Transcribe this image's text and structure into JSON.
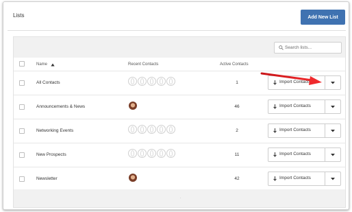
{
  "page": {
    "title": "Lists"
  },
  "toolbar": {
    "add_button_label": "Add New List"
  },
  "search": {
    "placeholder": "Search lists..."
  },
  "table": {
    "headers": {
      "name": "Name",
      "recent": "Recent Contacts",
      "active": "Active Contacts"
    },
    "sort_column": "Name",
    "sort_direction": "ascending",
    "rows": [
      {
        "name": "All Contacts",
        "active": "1",
        "recent_avatars": "placeholders"
      },
      {
        "name": "Announcements & News",
        "active": "46",
        "recent_avatars": "photo"
      },
      {
        "name": "Networking Events",
        "active": "2",
        "recent_avatars": "placeholders"
      },
      {
        "name": "New Prospects",
        "active": "11",
        "recent_avatars": "placeholders"
      },
      {
        "name": "Newsletter",
        "active": "42",
        "recent_avatars": "photo"
      }
    ],
    "import_label": "Import Contacts"
  },
  "colors": {
    "primary_button": "#3f72b1",
    "annotation_arrow": "#e8262a"
  }
}
